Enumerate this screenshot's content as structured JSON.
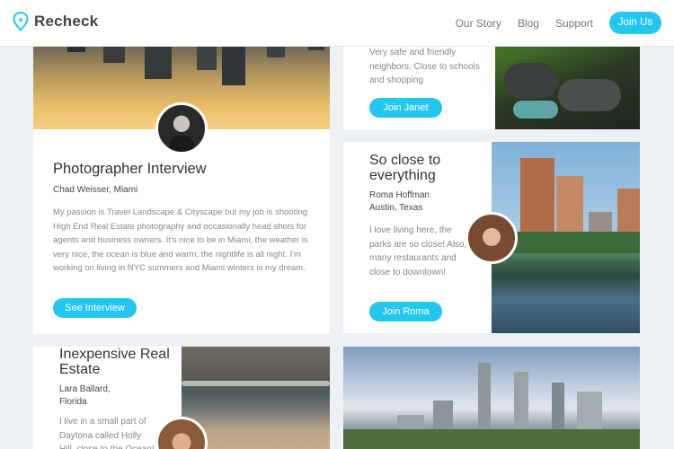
{
  "header": {
    "brand": "Recheck",
    "nav": [
      "Our Story",
      "Blog",
      "Support"
    ],
    "cta": "Join Us",
    "accent": "#23c7ee"
  },
  "cards": [
    {
      "title": "Photographer Interview",
      "subtitle": "Chad Weisser, Miami",
      "body": "My passion is Travel Landscape & Cityscape but my job is shooting High End Real Estate photography and occasionally head shots for agents and business owners. It's nice to be in Miami, the weather is very nice, the ocean is blue and warm, the nightlife is all night. I'm working on living in NYC summers and Miami winters is my dream.",
      "button": "See Interview",
      "photo": "city-skyline-sunset-photo",
      "avatar": "man-portrait-avatar"
    },
    {
      "body": "Very safe and friendly neighbors. Close to schools and shopping",
      "button": "Join Janet",
      "photo": "creek-rocks-photo"
    },
    {
      "title": "So close to everything",
      "subtitle_name": "Roma Hoffman",
      "subtitle_place": "Austin, Texas",
      "body": "I love living here, the parks are so close! Also, many restaurants and close to downtown!",
      "button": "Join Roma",
      "photo": "austin-riverfront-photo",
      "avatar": "woman-portrait-avatar"
    },
    {
      "title": "Inexpensive Real Estate",
      "subtitle_name": "Lara Ballard,",
      "subtitle_place": "Florida",
      "body": "I live in a small part of Daytona called Holly Hill, close to the Ocean!",
      "photo": "beach-waves-photo",
      "avatar": "woman-sunglasses-avatar"
    },
    {
      "photo": "philadelphia-skyline-photo"
    }
  ]
}
